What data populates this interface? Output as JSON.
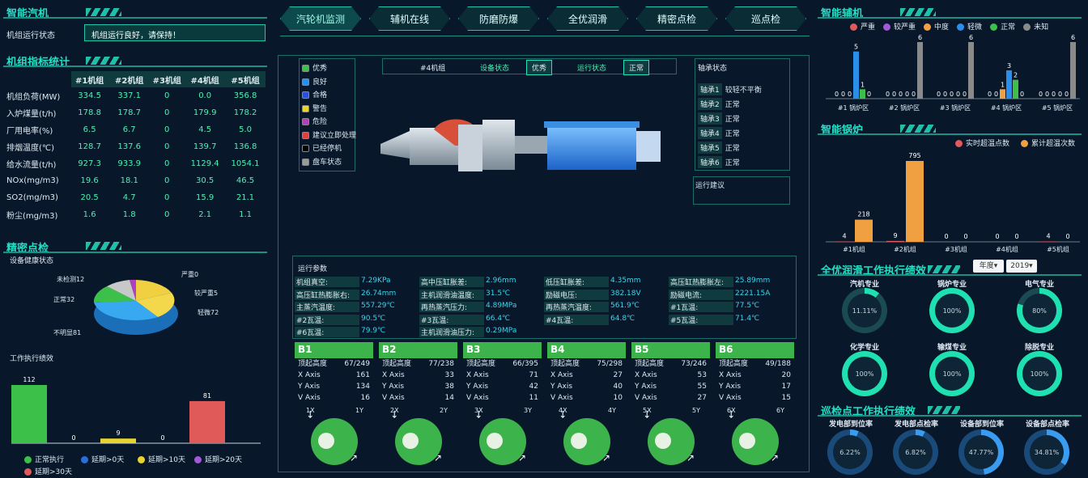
{
  "left": {
    "smart_turbine": {
      "title": "智能汽机",
      "status_label": "机组运行状态",
      "status_text": "机组运行良好，请保持！"
    },
    "unit_stats": {
      "title": "机组指标统计",
      "headers": [
        "#1机组",
        "#2机组",
        "#3机组",
        "#4机组",
        "#5机组"
      ],
      "rows": [
        {
          "label": "机组负荷(MW)",
          "values": [
            "334.5",
            "337.1",
            "0",
            "0.0",
            "356.8"
          ]
        },
        {
          "label": "入炉煤量(t/h)",
          "values": [
            "178.8",
            "178.7",
            "0",
            "179.9",
            "178.2"
          ]
        },
        {
          "label": "厂用电率(%)",
          "values": [
            "6.5",
            "6.7",
            "0",
            "4.5",
            "5.0"
          ]
        },
        {
          "label": "排烟温度(℃)",
          "values": [
            "128.7",
            "137.6",
            "0",
            "139.7",
            "136.8"
          ]
        },
        {
          "label": "给水流量(t/h)",
          "values": [
            "927.3",
            "933.9",
            "0",
            "1129.4",
            "1054.1"
          ]
        },
        {
          "label": "NOx(mg/m3)",
          "values": [
            "19.6",
            "18.1",
            "0",
            "30.5",
            "46.5"
          ]
        },
        {
          "label": "SO2(mg/m3)",
          "values": [
            "20.5",
            "4.7",
            "0",
            "15.9",
            "21.1"
          ]
        },
        {
          "label": "粉尘(mg/m3)",
          "values": [
            "1.6",
            "1.8",
            "0",
            "2.1",
            "1.1"
          ]
        }
      ]
    },
    "precision_check": {
      "title": "精密点检",
      "subtitle": "设备健康状态",
      "pie_labels": [
        {
          "text": "严重0"
        },
        {
          "text": "较严重5"
        },
        {
          "text": "轻微72"
        },
        {
          "text": "不明显81"
        },
        {
          "text": "正常32"
        },
        {
          "text": "未检测12"
        }
      ]
    },
    "work_perf": {
      "title": "工作执行绩效"
    }
  },
  "perf_chart": {
    "type": "bar",
    "categories": [
      "正常执行",
      "延期>0天",
      "延期>10天",
      "延期>20天",
      "延期>30天"
    ],
    "values": [
      112,
      0,
      9,
      0,
      81
    ],
    "colors": [
      "#3cc04a",
      "#2a6fd8",
      "#e9d42b",
      "#a259d9",
      "#e05a5a"
    ]
  },
  "center": {
    "tabs": [
      "汽轮机监测",
      "辅机在线",
      "防磨防爆",
      "全优润滑",
      "精密点检",
      "巡点检"
    ],
    "status_legend": [
      {
        "label": "优秀",
        "color": "#3cc04a"
      },
      {
        "label": "良好",
        "color": "#2a8fe8"
      },
      {
        "label": "合格",
        "color": "#2a4fd8"
      },
      {
        "label": "警告",
        "color": "#e9d42b"
      },
      {
        "label": "危险",
        "color": "#b040c0"
      },
      {
        "label": "建议立即处理",
        "color": "#e04040"
      },
      {
        "label": "已经停机",
        "color": "#000000"
      },
      {
        "label": "盘车状态",
        "color": "#9a9a9a"
      }
    ],
    "unit_bar": {
      "unit": "#4机组",
      "device_label": "设备状态",
      "device_value": "优秀",
      "run_label": "运行状态",
      "run_value": "正常"
    },
    "bearing": {
      "title": "轴承状态",
      "items": [
        {
          "name": "轴承1",
          "state": "较轻不平衡"
        },
        {
          "name": "轴承2",
          "state": "正常"
        },
        {
          "name": "轴承3",
          "state": "正常"
        },
        {
          "name": "轴承4",
          "state": "正常"
        },
        {
          "name": "轴承5",
          "state": "正常"
        },
        {
          "name": "轴承6",
          "state": "正常"
        }
      ]
    },
    "advice_title": "运行建议",
    "params": {
      "title": "运行参数",
      "rows": [
        [
          [
            "机组真空:",
            "7.29KPa"
          ],
          [
            "高中压缸胀差:",
            "2.96mm"
          ],
          [
            "低压缸胀差:",
            "4.35mm"
          ],
          [
            "高压缸热膨胀左:",
            "25.89mm"
          ]
        ],
        [
          [
            "高压缸热膨胀右:",
            "26.74mm"
          ],
          [
            "主机润滑油温度:",
            "31.5℃"
          ],
          [
            "励磁电压:",
            "382.18V"
          ],
          [
            "励磁电流:",
            "2221.15A"
          ]
        ],
        [
          [
            "主蒸汽温度:",
            "557.29℃"
          ],
          [
            "再热蒸汽压力:",
            "4.89MPa"
          ],
          [
            "再热蒸汽温度:",
            "561.9℃"
          ],
          [
            "#1瓦温:",
            "77.5℃"
          ]
        ],
        [
          [
            "#2瓦温:",
            "90.5℃"
          ],
          [
            "#3瓦温:",
            "66.4℃"
          ],
          [
            "#4瓦温:",
            "64.8℃"
          ],
          [
            "#5瓦温:",
            "71.4℃"
          ]
        ],
        [
          [
            "#6瓦温:",
            "79.9℃"
          ],
          [
            "主机润滑油压力:",
            "0.29MPa"
          ]
        ]
      ]
    },
    "bearings_cards": [
      {
        "id": "B1",
        "rows": [
          [
            "顶起高度",
            "67/249"
          ],
          [
            "X Axis",
            "161"
          ],
          [
            "Y Axis",
            "134"
          ],
          [
            "V Axis",
            "16"
          ]
        ],
        "axes": [
          "1X",
          "1Y"
        ]
      },
      {
        "id": "B2",
        "rows": [
          [
            "顶起高度",
            "77/238"
          ],
          [
            "X Axis",
            "33"
          ],
          [
            "Y Axis",
            "38"
          ],
          [
            "V Axis",
            "14"
          ]
        ],
        "axes": [
          "2X",
          "2Y"
        ]
      },
      {
        "id": "B3",
        "rows": [
          [
            "顶起高度",
            "66/395"
          ],
          [
            "X Axis",
            "71"
          ],
          [
            "Y Axis",
            "42"
          ],
          [
            "V Axis",
            "11"
          ]
        ],
        "axes": [
          "3X",
          "3Y"
        ]
      },
      {
        "id": "B4",
        "rows": [
          [
            "顶起高度",
            "75/298"
          ],
          [
            "X Axis",
            "27"
          ],
          [
            "Y Axis",
            "40"
          ],
          [
            "V Axis",
            "10"
          ]
        ],
        "axes": [
          "4X",
          "4Y"
        ]
      },
      {
        "id": "B5",
        "rows": [
          [
            "顶起高度",
            "73/246"
          ],
          [
            "X Axis",
            "53"
          ],
          [
            "Y Axis",
            "55"
          ],
          [
            "V Axis",
            "27"
          ]
        ],
        "axes": [
          "5X",
          "5Y"
        ]
      },
      {
        "id": "B6",
        "rows": [
          [
            "顶起高度",
            "49/188"
          ],
          [
            "X Axis",
            "20"
          ],
          [
            "Y Axis",
            "17"
          ],
          [
            "V Axis",
            "15"
          ]
        ],
        "axes": [
          "6X",
          "6Y"
        ]
      }
    ]
  },
  "right": {
    "aux": {
      "title": "智能辅机",
      "legend": [
        {
          "label": "严重",
          "color": "#e05a5a"
        },
        {
          "label": "较严重",
          "color": "#a259d9"
        },
        {
          "label": "中度",
          "color": "#f0a040"
        },
        {
          "label": "轻微",
          "color": "#2a8fe8"
        },
        {
          "label": "正常",
          "color": "#3cc04a"
        },
        {
          "label": "未知",
          "color": "#8a8a8a"
        }
      ]
    },
    "boiler": {
      "title": "智能锅炉",
      "legend": [
        {
          "label": "实时超温点数",
          "color": "#e05a5a"
        },
        {
          "label": "累计超温次数",
          "color": "#f0a040"
        }
      ]
    },
    "lube": {
      "title": "全优润滑工作执行绩效",
      "sel1": "年度▾",
      "sel2": "2019▾",
      "rings": [
        {
          "label": "汽机专业",
          "value": "11.11%"
        },
        {
          "label": "锅炉专业",
          "value": "100%"
        },
        {
          "label": "电气专业",
          "value": "80%"
        },
        {
          "label": "化学专业",
          "value": "100%"
        },
        {
          "label": "输煤专业",
          "value": "100%"
        },
        {
          "label": "除脱专业",
          "value": "100%"
        }
      ]
    },
    "patrol": {
      "title": "巡检点工作执行绩效",
      "rings": [
        {
          "label": "发电部到位率",
          "value": "6.22%"
        },
        {
          "label": "发电部点检率",
          "value": "6.82%"
        },
        {
          "label": "设备部到位率",
          "value": "47.77%"
        },
        {
          "label": "设备部点检率",
          "value": "34.81%"
        }
      ]
    }
  },
  "chart_data": [
    {
      "type": "bar",
      "title": "智能辅机",
      "categories": [
        "#1 锅炉区",
        "#2 锅炉区",
        "#3 锅炉区",
        "#4 锅炉区",
        "#5 锅炉区"
      ],
      "series": [
        {
          "name": "严重",
          "values": [
            0,
            0,
            0,
            0,
            0
          ]
        },
        {
          "name": "较严重",
          "values": [
            0,
            0,
            0,
            0,
            0
          ]
        },
        {
          "name": "中度",
          "values": [
            0,
            0,
            0,
            1,
            0
          ]
        },
        {
          "name": "轻微",
          "values": [
            5,
            0,
            0,
            3,
            0
          ]
        },
        {
          "name": "正常",
          "values": [
            1,
            0,
            0,
            2,
            0
          ]
        },
        {
          "name": "未知",
          "values": [
            0,
            6,
            6,
            0,
            6
          ]
        }
      ]
    },
    {
      "type": "bar",
      "title": "智能锅炉",
      "categories": [
        "#1机组",
        "#2机组",
        "#3机组",
        "#4机组",
        "#5机组"
      ],
      "series": [
        {
          "name": "实时超温点数",
          "values": [
            4,
            9,
            0,
            0,
            4
          ]
        },
        {
          "name": "累计超温次数",
          "values": [
            218,
            795,
            0,
            0,
            0
          ]
        }
      ]
    },
    {
      "type": "bar",
      "title": "工作执行绩效",
      "categories": [
        "正常执行",
        "延期>0天",
        "延期>10天",
        "延期>20天",
        "延期>30天"
      ],
      "values": [
        112,
        0,
        9,
        0,
        81
      ]
    }
  ]
}
